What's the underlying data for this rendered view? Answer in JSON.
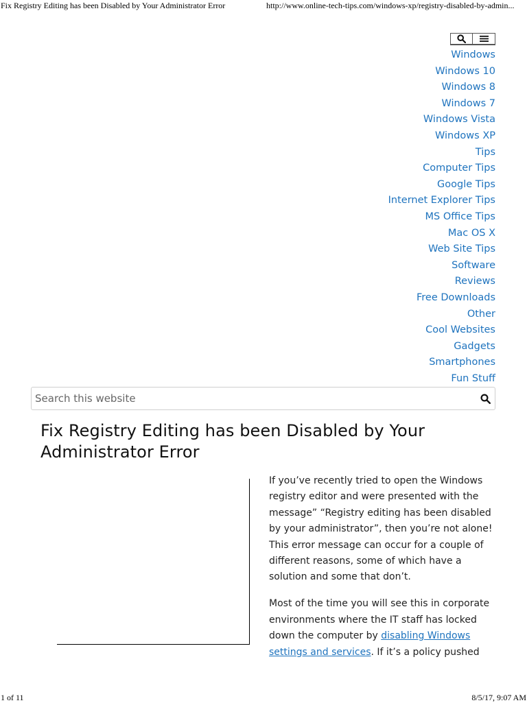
{
  "print_header": {
    "title": "Fix Registry Editing has been Disabled by Your Administrator Error",
    "url": "http://www.online-tech-tips.com/windows-xp/registry-disabled-by-admin..."
  },
  "top_buttons": {
    "search_icon": "search-icon",
    "menu_icon": "hamburger-menu-icon"
  },
  "nav": {
    "items": [
      "Windows",
      "Windows 10",
      "Windows 8",
      "Windows 7",
      "Windows Vista",
      "Windows XP",
      "Tips",
      "Computer Tips",
      "Google Tips",
      "Internet Explorer Tips",
      "MS Office Tips",
      "Mac OS X",
      "Web Site Tips",
      "Software",
      "Reviews",
      "Free Downloads",
      "Other",
      "Cool Websites",
      "Gadgets",
      "Smartphones",
      "Fun Stuff"
    ]
  },
  "search": {
    "placeholder": "Search this website"
  },
  "article": {
    "title": "Fix Registry Editing has been Disabled by Your Administrator Error",
    "p1": "If you’ve recently tried to open the Windows registry editor and were presented with the message” “Registry editing has been disabled by your administrator”, then you’re not alone! This error message can occur for a couple of different reasons, some of which have a solution and some that don’t.",
    "p2_before": "Most of the time you will see this in corporate environments where the IT staff has locked down the computer by ",
    "p2_link": "disabling Windows settings and services",
    "p2_after": ". If it’s a policy pushed"
  },
  "print_footer": {
    "page": "1 of 11",
    "timestamp": "8/5/17, 9:07 AM"
  },
  "colors": {
    "link": "#1e73be",
    "text": "#222222"
  }
}
